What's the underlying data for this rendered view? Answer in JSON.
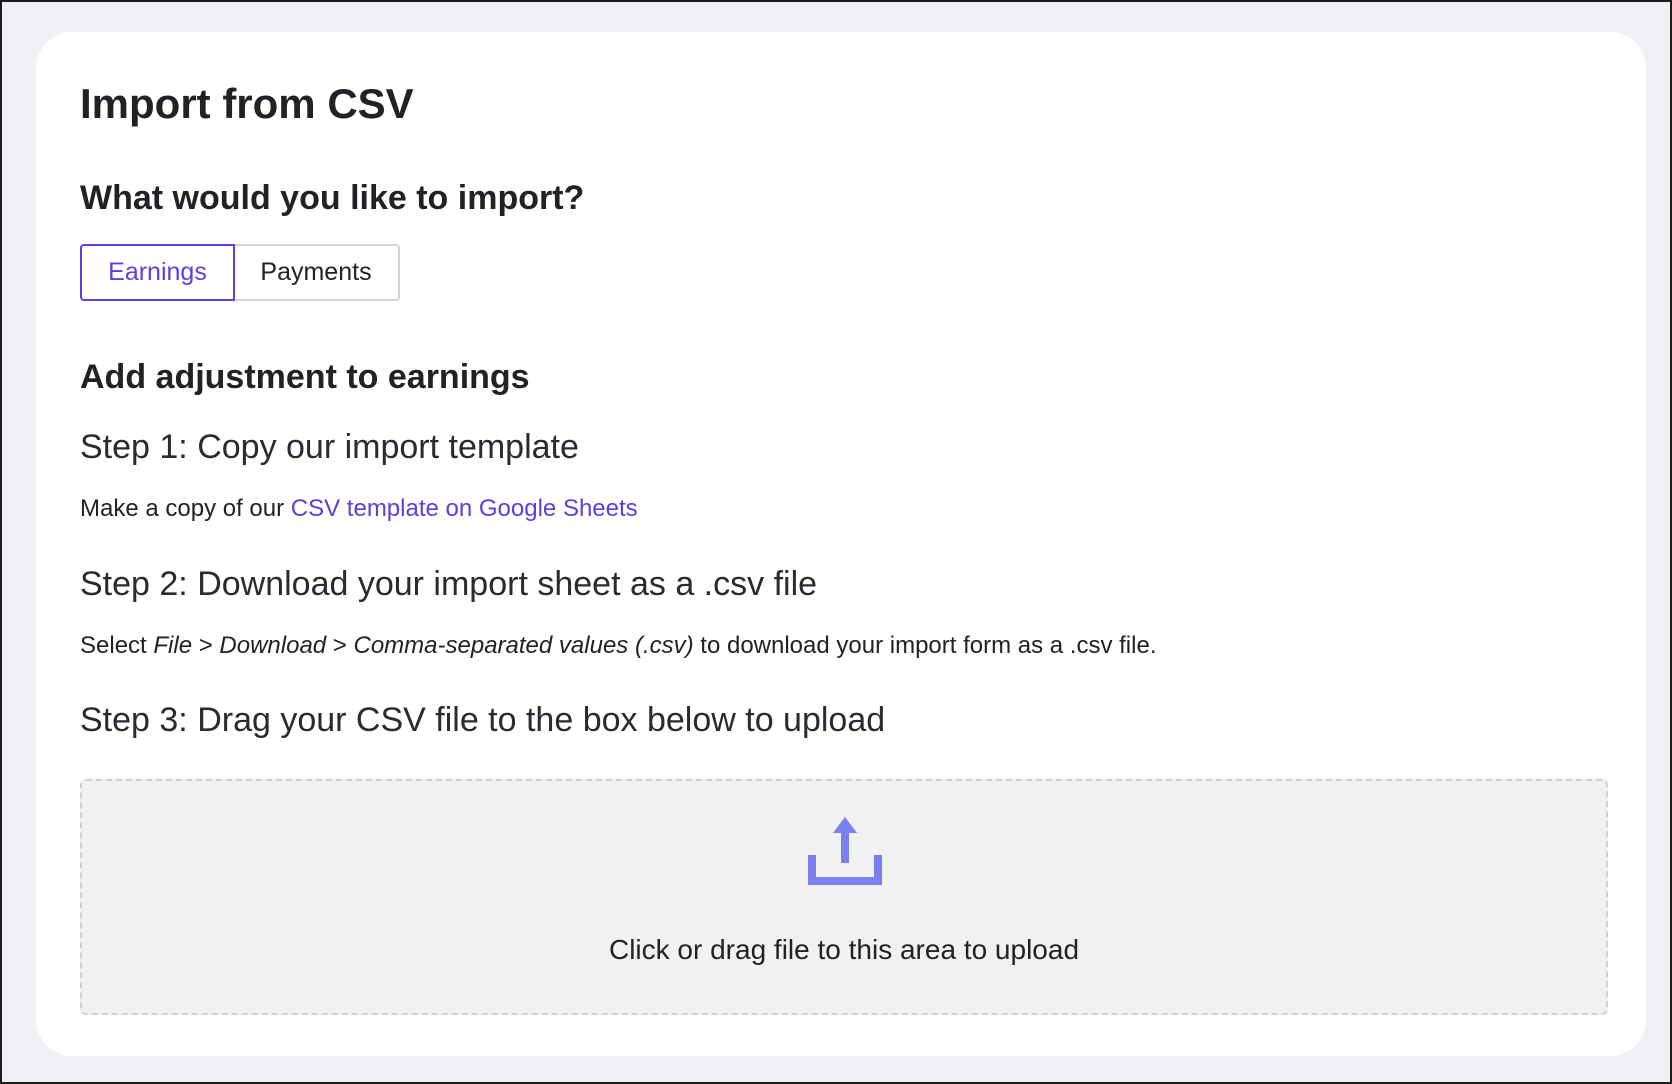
{
  "page": {
    "title": "Import from CSV"
  },
  "import_type": {
    "question": "What would you like to import?",
    "options": [
      {
        "label": "Earnings",
        "selected": true
      },
      {
        "label": "Payments",
        "selected": false
      }
    ]
  },
  "adjustment": {
    "heading": "Add adjustment to earnings",
    "step1": {
      "title": "Step 1: Copy our import template",
      "text_prefix": "Make a copy of our ",
      "link_text": "CSV template on Google Sheets"
    },
    "step2": {
      "title": "Step 2: Download your import sheet as a .csv file",
      "text_prefix": "Select ",
      "path_file": "File",
      "separator1": " > ",
      "path_download": "Download",
      "separator2": " > ",
      "path_format": "Comma-separated values (.csv)",
      "text_suffix": " to download your import form as a .csv file."
    },
    "step3": {
      "title": "Step 3: Drag your CSV file to the box below to upload"
    }
  },
  "dropzone": {
    "icon": "upload-icon",
    "text": "Click or drag file to this area to upload"
  },
  "colors": {
    "accent": "#5b3fe0",
    "upload_icon": "#7b7ff0",
    "page_background": "#f0f1f4",
    "card_background": "#ffffff",
    "dropzone_background": "#f1f1f1"
  }
}
